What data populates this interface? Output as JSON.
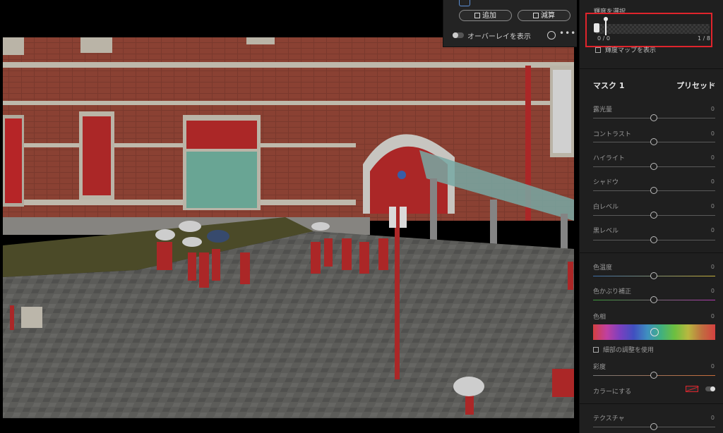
{
  "popup": {
    "add_label": "追加",
    "subtract_label": "減算",
    "overlay_label": "オーバーレイを表示",
    "more_label": "•••"
  },
  "luminance": {
    "title": "輝度を選択",
    "left_value": "0 / 0",
    "right_value": "1 / 8",
    "map_label": "輝度マップを表示"
  },
  "mask": {
    "title": "マスク 1",
    "preset_label": "プリセット",
    "chevron": "⌄"
  },
  "adjustments": {
    "exposure": {
      "label": "露光量",
      "value": "0"
    },
    "contrast": {
      "label": "コントラスト",
      "value": "0"
    },
    "highlights": {
      "label": "ハイライト",
      "value": "0"
    },
    "shadows": {
      "label": "シャドウ",
      "value": "0"
    },
    "whites": {
      "label": "白レベル",
      "value": "0"
    },
    "blacks": {
      "label": "黒レベル",
      "value": "0"
    },
    "temp": {
      "label": "色温度",
      "value": "0"
    },
    "tint": {
      "label": "色かぶり補正",
      "value": "0"
    },
    "hue": {
      "label": "色相",
      "value": "0"
    },
    "fine_adjust_label": "細部の調整を使用",
    "saturation": {
      "label": "彩度",
      "value": "0"
    },
    "colorize_label": "カラーにする",
    "texture": {
      "label": "テクスチャ",
      "value": "0"
    }
  },
  "colors": {
    "accent_red": "#e0242c",
    "panel_bg": "#1f1f1f"
  }
}
